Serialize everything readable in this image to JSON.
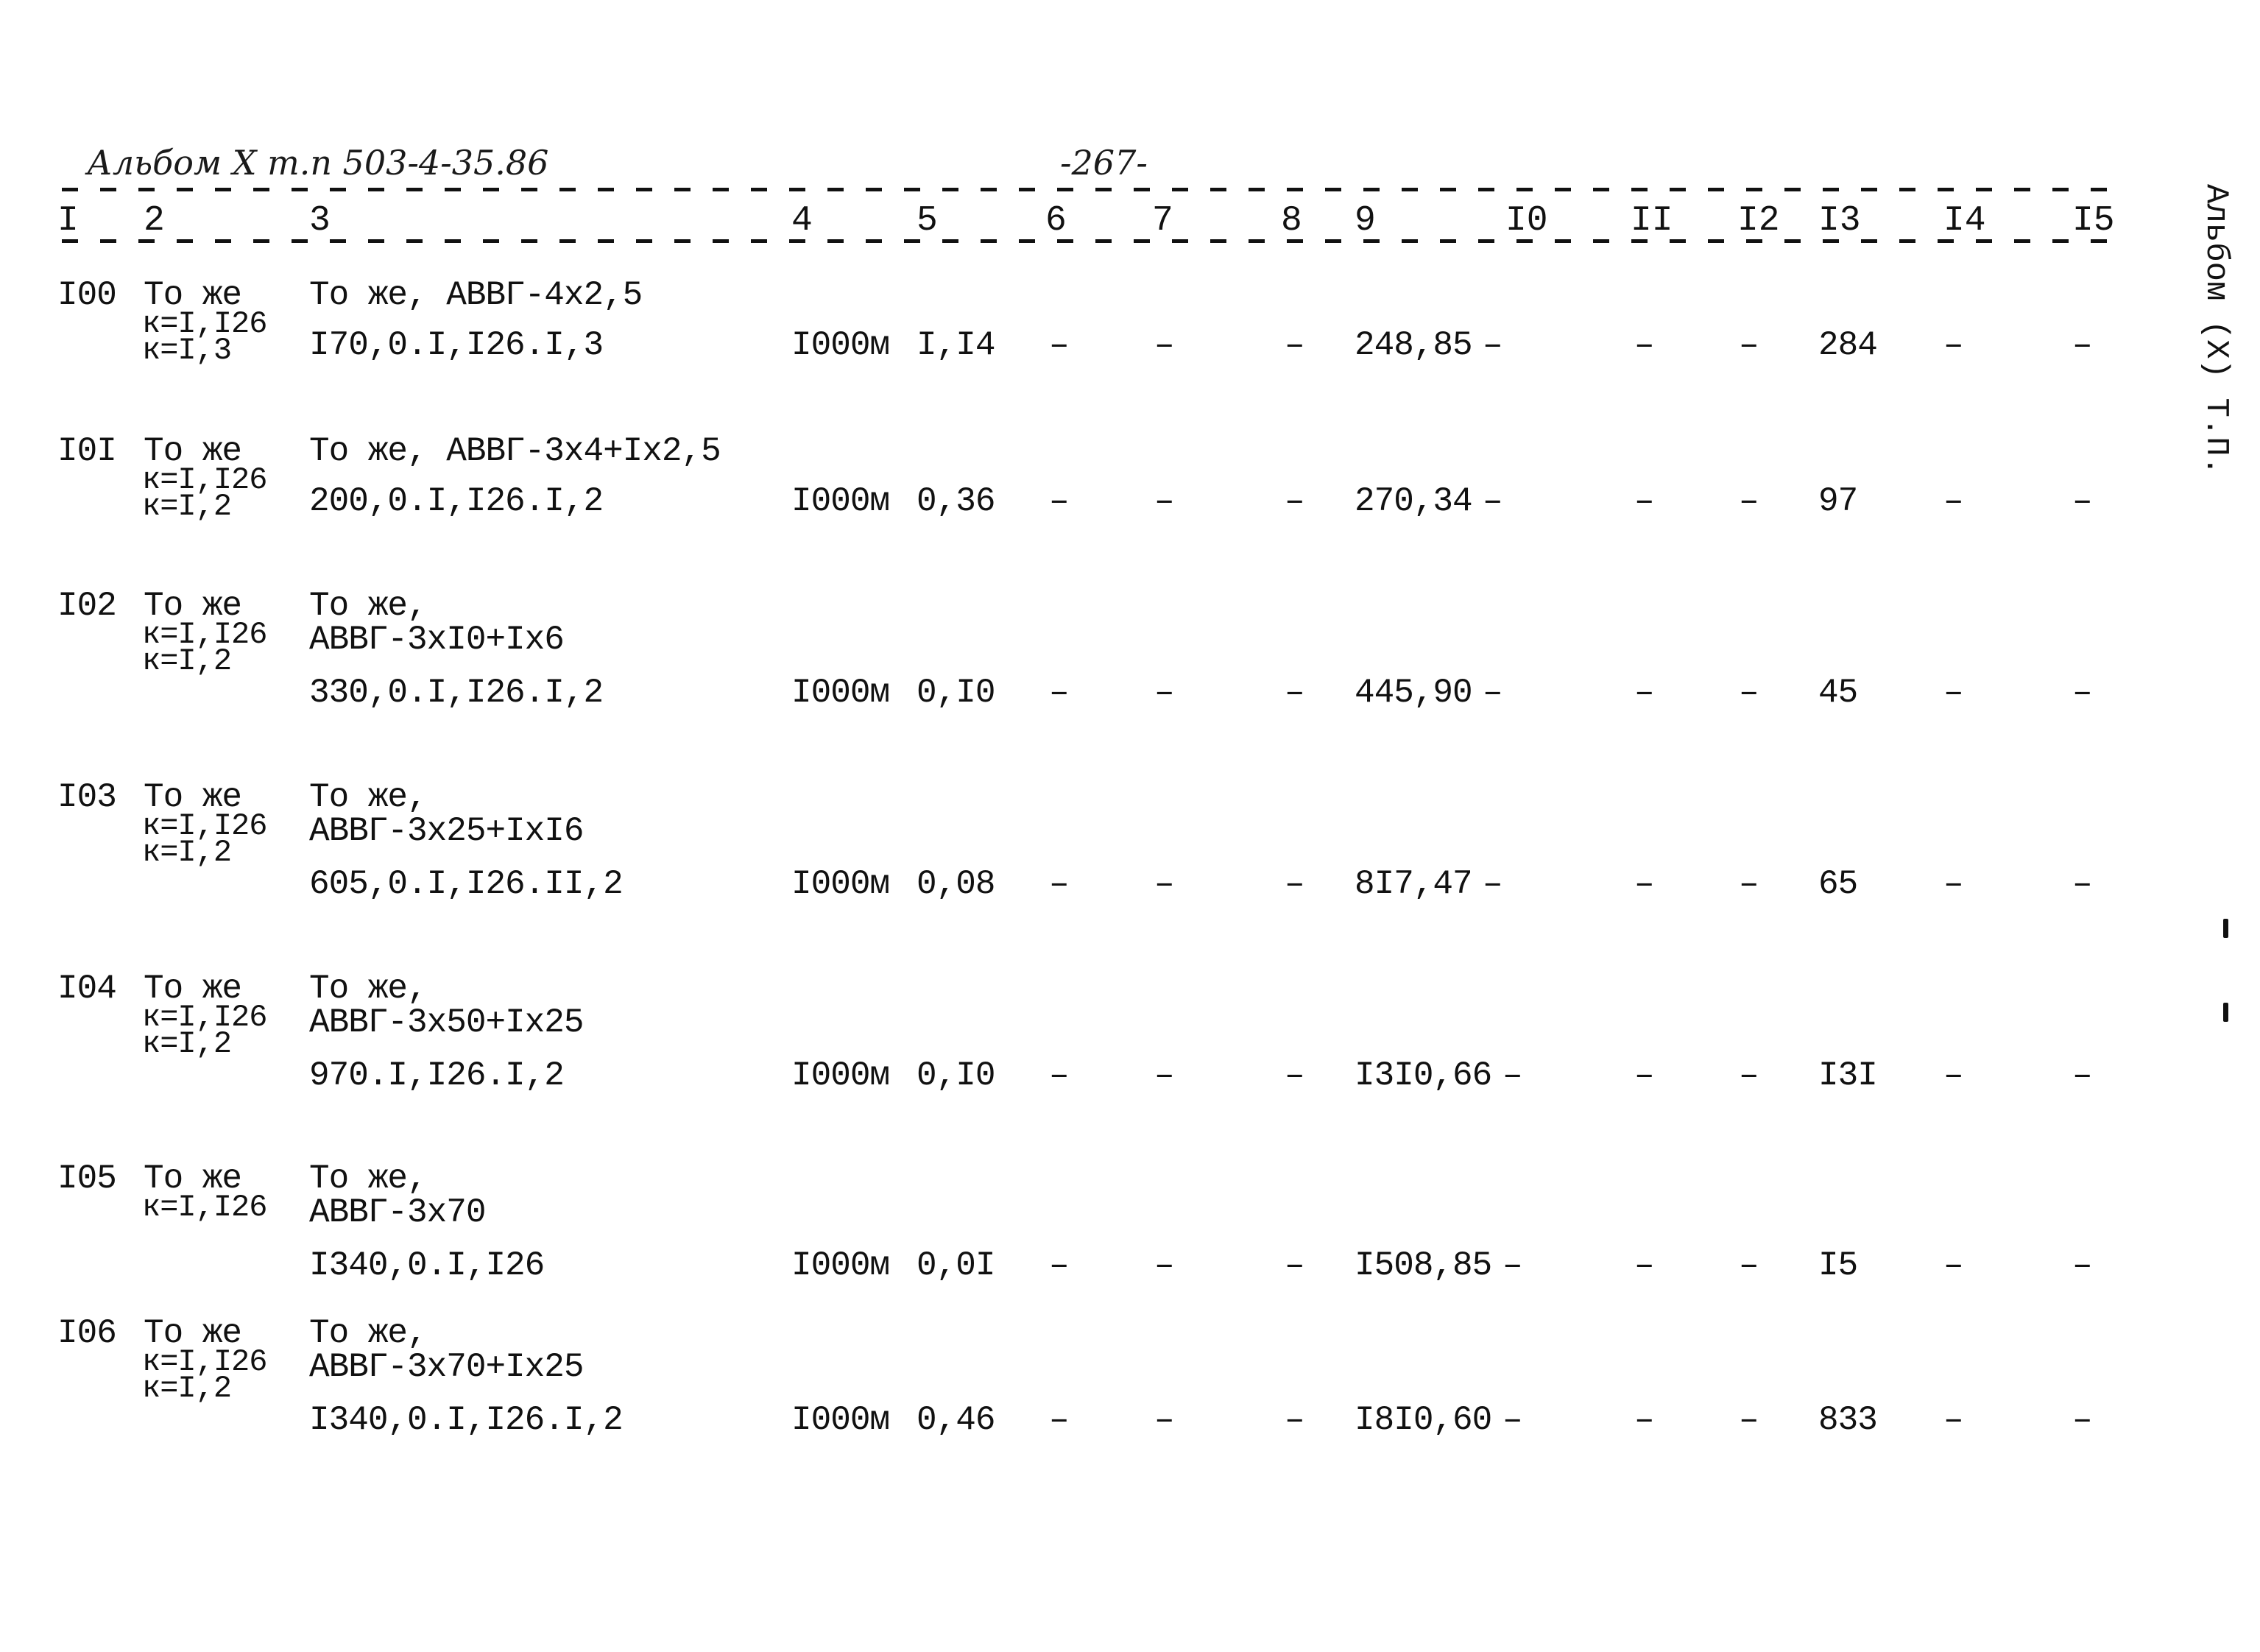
{
  "header": {
    "title": "Альбом X т.п 503-4-35.86",
    "page_number": "-267-"
  },
  "side_label": "Альбом (X) Т.П.",
  "columns": [
    "I",
    "2",
    "3",
    "4",
    "5",
    "6",
    "7",
    "8",
    "9",
    "I0",
    "II",
    "I2",
    "I3",
    "I4",
    "I5"
  ],
  "rows": [
    {
      "num": "I00",
      "c2": [
        "То же",
        "к=I,I26",
        "к=I,3"
      ],
      "c3": [
        "То же, АВВГ-4х2,5",
        "I70,0.I,I26.I,3"
      ],
      "c4": "I000м",
      "c5": "I,I4",
      "c6": "–",
      "c7": "–",
      "c8": "–",
      "c9": "248,85",
      "c10": "–",
      "c11": "–",
      "c12": "–",
      "c13": "284",
      "c14": "–",
      "c15": "–"
    },
    {
      "num": "I0I",
      "c2": [
        "То же",
        "к=I,I26",
        "к=I,2"
      ],
      "c3": [
        "То же, АВВГ-3х4+Iх2,5",
        "200,0.I,I26.I,2"
      ],
      "c4": "I000м",
      "c5": "0,36",
      "c6": "–",
      "c7": "–",
      "c8": "–",
      "c9": "270,34",
      "c10": "–",
      "c11": "–",
      "c12": "–",
      "c13": "97",
      "c14": "–",
      "c15": "–"
    },
    {
      "num": "I02",
      "c2": [
        "То же",
        "к=I,I26",
        "к=I,2"
      ],
      "c3": [
        "То же,",
        "АВВГ-3хI0+Iх6",
        "330,0.I,I26.I,2"
      ],
      "c4": "I000м",
      "c5": "0,I0",
      "c6": "–",
      "c7": "–",
      "c8": "–",
      "c9": "445,90",
      "c10": "–",
      "c11": "–",
      "c12": "–",
      "c13": "45",
      "c14": "–",
      "c15": "–"
    },
    {
      "num": "I03",
      "c2": [
        "То же",
        "к=I,I26",
        "к=I,2"
      ],
      "c3": [
        "То же,",
        "АВВГ-3х25+IхI6",
        "605,0.I,I26.II,2"
      ],
      "c4": "I000м",
      "c5": "0,08",
      "c6": "–",
      "c7": "–",
      "c8": "–",
      "c9": "8I7,47",
      "c10": "–",
      "c11": "–",
      "c12": "–",
      "c13": "65",
      "c14": "–",
      "c15": "–"
    },
    {
      "num": "I04",
      "c2": [
        "То же",
        "к=I,I26",
        "к=I,2"
      ],
      "c3": [
        "То же,",
        "АВВГ-3х50+Iх25",
        "970.I,I26.I,2"
      ],
      "c4": "I000м",
      "c5": "0,I0",
      "c6": "–",
      "c7": "–",
      "c8": "–",
      "c9": "I3I0,66",
      "c10": "–",
      "c11": "–",
      "c12": "–",
      "c13": "I3I",
      "c14": "–",
      "c15": "–"
    },
    {
      "num": "I05",
      "c2": [
        "То же",
        "к=I,I26",
        ""
      ],
      "c3": [
        "То же,",
        "АВВГ-3х70",
        "I340,0.I,I26"
      ],
      "c4": "I000м",
      "c5": "0,0I",
      "c6": "–",
      "c7": "–",
      "c8": "–",
      "c9": "I508,85",
      "c10": "–",
      "c11": "–",
      "c12": "–",
      "c13": "I5",
      "c14": "–",
      "c15": "–"
    },
    {
      "num": "I06",
      "c2": [
        "То же",
        "к=I,I26",
        "к=I,2"
      ],
      "c3": [
        "То же,",
        "АВВГ-3х70+Iх25",
        "I340,0.I,I26.I,2"
      ],
      "c4": "I000м",
      "c5": "0,46",
      "c6": "–",
      "c7": "–",
      "c8": "–",
      "c9": "I8I0,60",
      "c10": "–",
      "c11": "–",
      "c12": "–",
      "c13": "833",
      "c14": "–",
      "c15": "–"
    }
  ]
}
